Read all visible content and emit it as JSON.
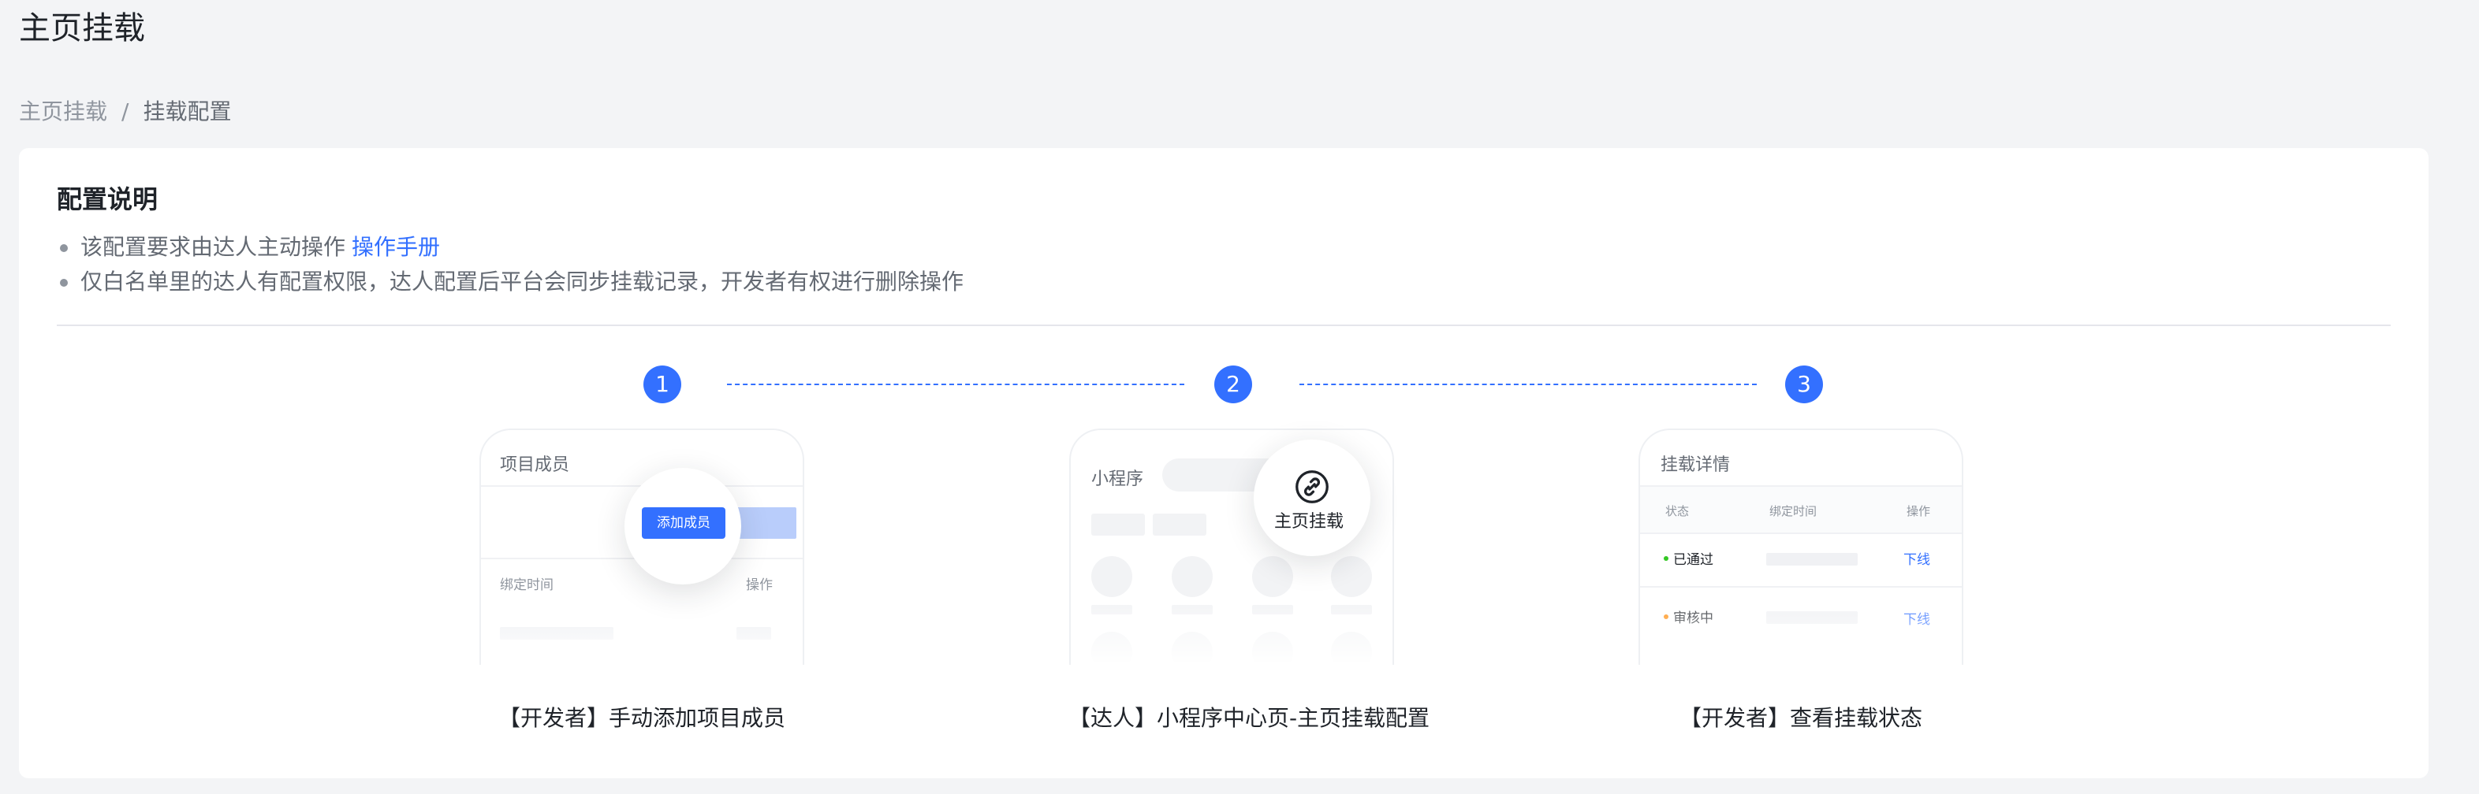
{
  "page": {
    "title": "主页挂载"
  },
  "breadcrumb": {
    "parent": "主页挂载",
    "separator": "/",
    "current": "挂载配置"
  },
  "config": {
    "title": "配置说明",
    "note1_text": "该配置要求由达人主动操作",
    "note1_link": "操作手册",
    "note2_text": "仅白名单里的达人有配置权限，达人配置后平台会同步挂载记录，开发者有权进行删除操作"
  },
  "colors": {
    "accent": "#3370ff",
    "success": "#34c724",
    "warning": "#ff8800"
  },
  "steps": [
    {
      "number": "1",
      "caption": "【开发者】手动添加项目成员",
      "mock": {
        "title": "项目成员",
        "button": "添加成员",
        "col_time": "绑定时间",
        "col_action": "操作"
      }
    },
    {
      "number": "2",
      "caption": "【达人】小程序中心页-主页挂载配置",
      "mock": {
        "title": "小程序",
        "icon": "link-icon",
        "highlight_label": "主页挂载"
      }
    },
    {
      "number": "3",
      "caption": "【开发者】查看挂载状态",
      "mock": {
        "title": "挂载详情",
        "col_status": "状态",
        "col_time": "绑定时间",
        "col_action": "操作",
        "rows": [
          {
            "status": "已通过",
            "action": "下线"
          },
          {
            "status": "审核中",
            "action": "下线"
          }
        ]
      }
    }
  ]
}
